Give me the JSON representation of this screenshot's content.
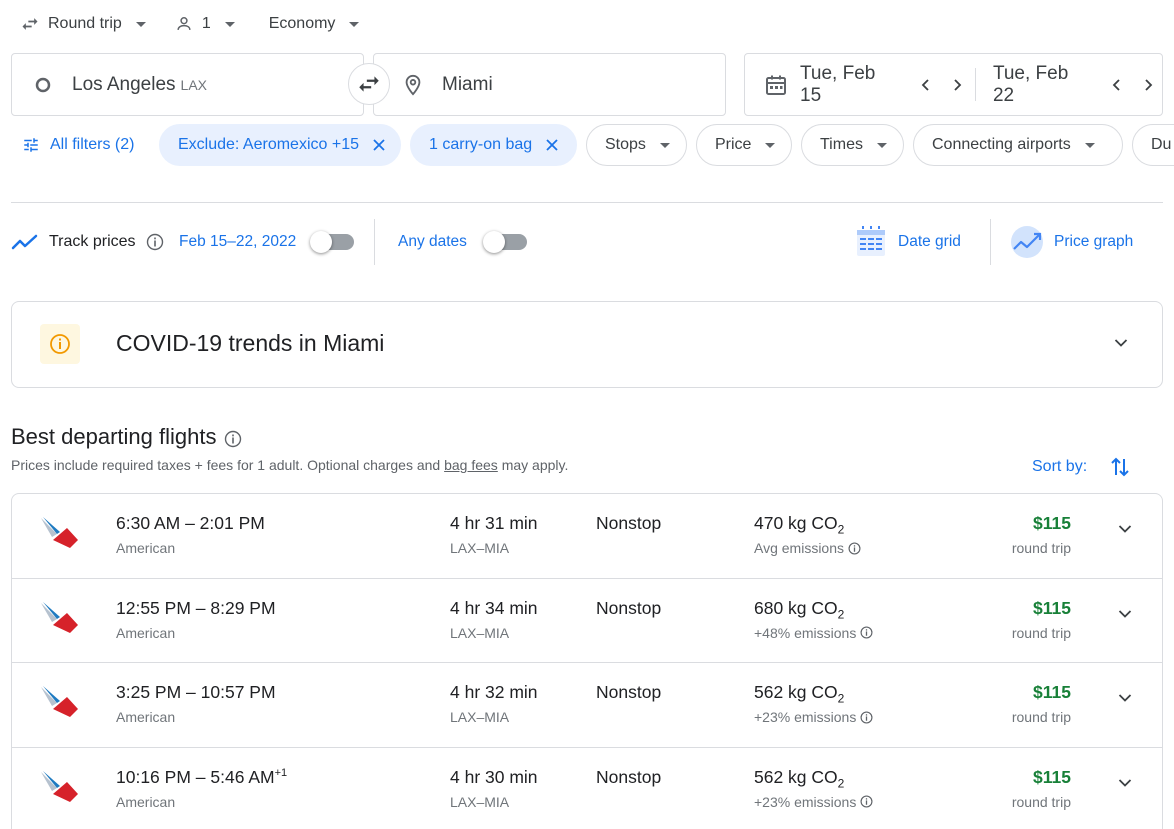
{
  "trip_options": {
    "trip_type": "Round trip",
    "passengers": "1",
    "cabin_class": "Economy"
  },
  "search": {
    "origin_city": "Los Angeles",
    "origin_code": "LAX",
    "destination": "Miami",
    "depart_date": "Tue, Feb 15",
    "return_date": "Tue, Feb 22"
  },
  "filters": {
    "all_filters": "All filters (2)",
    "chips": [
      {
        "label": "Exclude: Aeromexico +15",
        "active": true
      },
      {
        "label": "1 carry-on bag",
        "active": true
      },
      {
        "label": "Stops",
        "active": false
      },
      {
        "label": "Price",
        "active": false
      },
      {
        "label": "Times",
        "active": false
      },
      {
        "label": "Connecting airports",
        "active": false
      },
      {
        "label": "Du",
        "active": false
      }
    ]
  },
  "tracking": {
    "track_label": "Track prices",
    "date_range": "Feb 15–22, 2022",
    "any_dates": "Any dates",
    "date_grid": "Date grid",
    "price_graph": "Price graph"
  },
  "covid": {
    "title": "COVID-19 trends in Miami"
  },
  "results": {
    "heading": "Best departing flights",
    "subtitle_pre": "Prices include required taxes + fees for 1 adult. Optional charges and ",
    "subtitle_link": "bag fees",
    "subtitle_post": " may apply.",
    "sort_label": "Sort by:",
    "flights": [
      {
        "times": "6:30 AM – 2:01 PM",
        "next_day": "",
        "airline": "American",
        "duration": "4 hr 31 min",
        "route": "LAX–MIA",
        "stops": "Nonstop",
        "co2": "470 kg CO",
        "emissions": "Avg emissions",
        "price": "$115",
        "price_note": "round trip"
      },
      {
        "times": "12:55 PM – 8:29 PM",
        "next_day": "",
        "airline": "American",
        "duration": "4 hr 34 min",
        "route": "LAX–MIA",
        "stops": "Nonstop",
        "co2": "680 kg CO",
        "emissions": "+48% emissions",
        "price": "$115",
        "price_note": "round trip"
      },
      {
        "times": "3:25 PM – 10:57 PM",
        "next_day": "",
        "airline": "American",
        "duration": "4 hr 32 min",
        "route": "LAX–MIA",
        "stops": "Nonstop",
        "co2": "562 kg CO",
        "emissions": "+23% emissions",
        "price": "$115",
        "price_note": "round trip"
      },
      {
        "times": "10:16 PM – 5:46 AM",
        "next_day": "+1",
        "airline": "American",
        "duration": "4 hr 30 min",
        "route": "LAX–MIA",
        "stops": "Nonstop",
        "co2": "562 kg CO",
        "emissions": "+23% emissions",
        "price": "$115",
        "price_note": "round trip"
      }
    ]
  },
  "colors": {
    "accent": "#1a73e8",
    "price_green": "#188038",
    "chip_active_bg": "#e8f0fe",
    "border": "#dadce0"
  },
  "icons": {
    "swap_trip": "swap-horiz-icon",
    "origin": "circle-icon",
    "destination": "location-pin-icon",
    "calendar": "calendar-icon",
    "filters": "tune-icon",
    "track": "trending-icon",
    "info": "info-icon",
    "sort": "swap-vert-icon",
    "airline": "american-airlines-logo"
  }
}
